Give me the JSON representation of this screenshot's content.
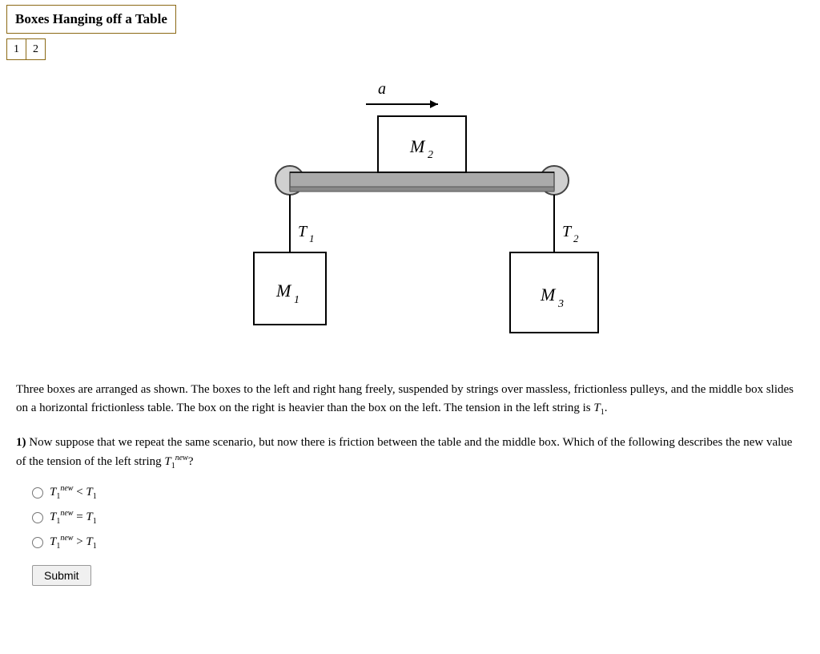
{
  "title": "Boxes Hanging off a Table",
  "tabs": [
    {
      "label": "1",
      "active": true
    },
    {
      "label": "2",
      "active": false
    }
  ],
  "diagram": {
    "M1_label": "M",
    "M1_sub": "1",
    "M2_label": "M",
    "M2_sub": "2",
    "M3_label": "M",
    "M3_sub": "3",
    "T1_label": "T",
    "T1_sub": "1",
    "T2_label": "T",
    "T2_sub": "2",
    "a_label": "a"
  },
  "description": "Three boxes are arranged as shown. The boxes to the left and right hang freely, suspended by strings over massless, frictionless pulleys, and the middle box slides on a horizontal frictionless table. The box on the right is heavier than the box on the left. The tension in the left string is T₁.",
  "question_number": "1)",
  "question_text": "Now suppose that we repeat the same scenario, but now there is friction between the table and the middle box. Which of the following describes the new value of the tension of the left string T₁ⁿᵉʷ?",
  "options": [
    {
      "id": "opt1",
      "label_main": "T₁ⁿᵉʷ < T₁"
    },
    {
      "id": "opt2",
      "label_main": "T₁ⁿᵉʷ = T₁"
    },
    {
      "id": "opt3",
      "label_main": "T₁ⁿᵉʷ > T₁"
    }
  ],
  "submit_label": "Submit"
}
